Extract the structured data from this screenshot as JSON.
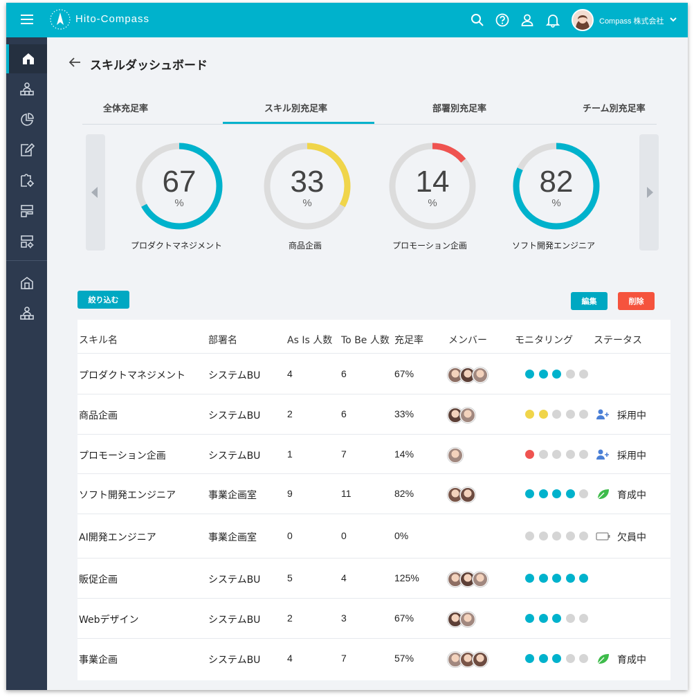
{
  "header": {
    "app_name": "Hito-Compass",
    "company": "Compass 株式会社"
  },
  "page": {
    "title": "スキルダッシュボード"
  },
  "tabs": [
    {
      "label": "全体充足率"
    },
    {
      "label": "スキル別充足率"
    },
    {
      "label": "部署別充足率"
    },
    {
      "label": "チーム別充足率"
    }
  ],
  "gauges": [
    {
      "value": "67",
      "unit": "%",
      "label": "プロダクトマネジメント",
      "fraction": 0.67,
      "color": "#00b2cc"
    },
    {
      "value": "33",
      "unit": "%",
      "label": "商品企画",
      "fraction": 0.33,
      "color": "#f0d54a"
    },
    {
      "value": "14",
      "unit": "%",
      "label": "プロモーション企画",
      "fraction": 0.14,
      "color": "#ef5350"
    },
    {
      "value": "82",
      "unit": "%",
      "label": "ソフト開発エンジニア",
      "fraction": 0.82,
      "color": "#00b2cc"
    }
  ],
  "toolbar": {
    "filter_label": "絞り込む",
    "edit_label": "編集",
    "delete_label": "削除"
  },
  "table": {
    "headers": {
      "skill": "スキル名",
      "dept": "部署名",
      "asis": "As Is 人数",
      "tobe": "To Be 人数",
      "rate": "充足率",
      "members": "メンバー",
      "monitoring": "モニタリング",
      "status": "ステータス"
    },
    "rows": [
      {
        "skill": "プロダクトマネジメント",
        "dept": "システムBU",
        "asis": "4",
        "tobe": "6",
        "rate": "67%",
        "member_count": 3,
        "dots": 3,
        "dot_color": "#00b2cc",
        "status": "",
        "status_icon": ""
      },
      {
        "skill": "商品企画",
        "dept": "システムBU",
        "asis": "2",
        "tobe": "6",
        "rate": "33%",
        "member_count": 2,
        "dots": 2,
        "dot_color": "#f0d54a",
        "status": "採用中",
        "status_icon": "add-user-icon"
      },
      {
        "skill": "プロモーション企画",
        "dept": "システムBU",
        "asis": "1",
        "tobe": "7",
        "rate": "14%",
        "member_count": 1,
        "dots": 1,
        "dot_color": "#ef5350",
        "status": "採用中",
        "status_icon": "add-user-icon"
      },
      {
        "skill": "ソフト開発エンジニア",
        "dept": "事業企画室",
        "asis": "9",
        "tobe": "11",
        "rate": "82%",
        "member_count": 2,
        "dots": 4,
        "dot_color": "#00b2cc",
        "status": "育成中",
        "status_icon": "leaf-icon"
      },
      {
        "skill": "AI開発エンジニア",
        "dept": "事業企画室",
        "asis": "0",
        "tobe": "0",
        "rate": "0%",
        "member_count": 0,
        "dots": 0,
        "dot_color": "#00b2cc",
        "status": "欠員中",
        "status_icon": "empty-battery-icon"
      },
      {
        "skill": "販促企画",
        "dept": "システムBU",
        "asis": "5",
        "tobe": "4",
        "rate": "125%",
        "member_count": 3,
        "dots": 5,
        "dot_color": "#00b2cc",
        "status": "",
        "status_icon": ""
      },
      {
        "skill": "Webデザイン",
        "dept": "システムBU",
        "asis": "2",
        "tobe": "3",
        "rate": "67%",
        "member_count": 2,
        "dots": 3,
        "dot_color": "#00b2cc",
        "status": "",
        "status_icon": ""
      },
      {
        "skill": "事業企画",
        "dept": "システムBU",
        "asis": "4",
        "tobe": "7",
        "rate": "57%",
        "member_count": 3,
        "dots": 3,
        "dot_color": "#00b2cc",
        "status": "育成中",
        "status_icon": "leaf-icon"
      }
    ]
  }
}
